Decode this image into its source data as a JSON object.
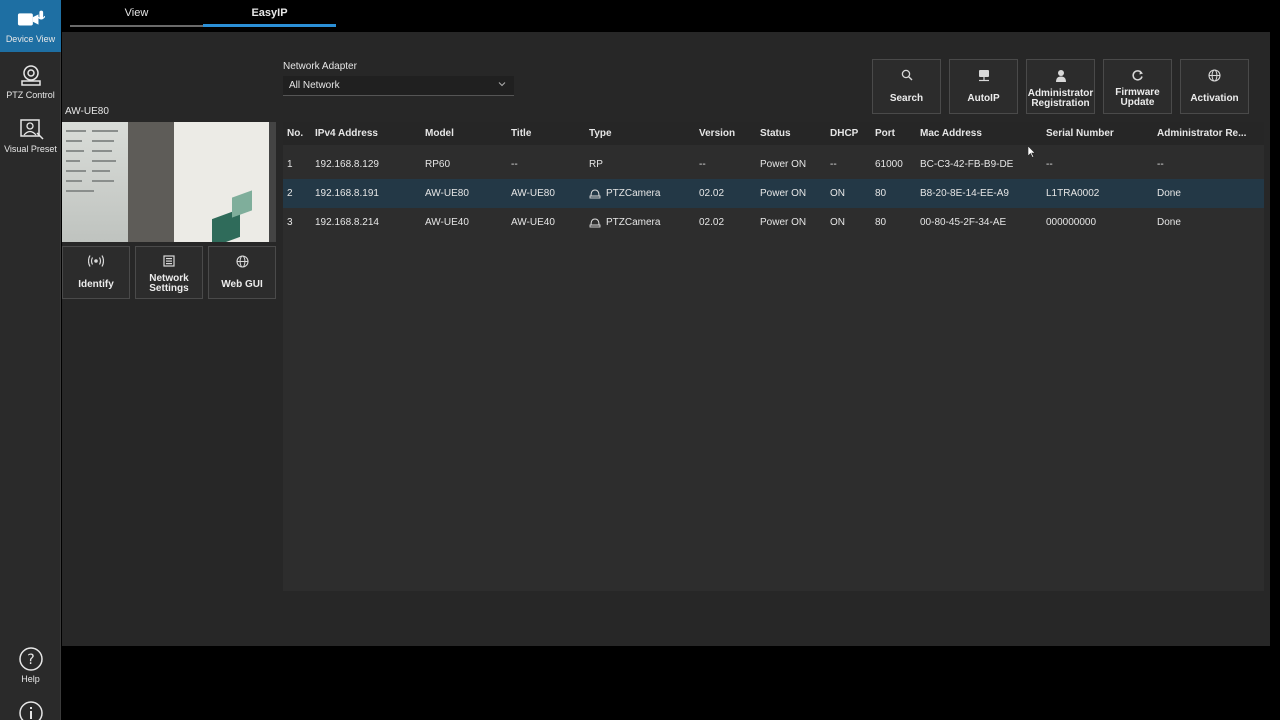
{
  "leftnav": {
    "items": [
      {
        "label": "Device View",
        "icon": "video-camera-mic-icon",
        "active": true
      },
      {
        "label": "PTZ Control",
        "icon": "ptz-camera-icon",
        "active": false
      },
      {
        "label": "Visual Preset",
        "icon": "visual-preset-icon",
        "active": false
      }
    ],
    "help_label": "Help"
  },
  "tabs": [
    {
      "label": "View",
      "active": false
    },
    {
      "label": "EasyIP",
      "active": true
    }
  ],
  "camera": {
    "title": "AW-UE80",
    "actions": [
      {
        "label": "Identify",
        "icon": "broadcast-icon"
      },
      {
        "label": "Network Settings",
        "line1": "Network",
        "line2": "Settings",
        "icon": "network-settings-icon"
      },
      {
        "label": "Web GUI",
        "icon": "globe-icon"
      }
    ]
  },
  "adapter": {
    "label": "Network Adapter",
    "value": "All Network"
  },
  "toolbar": {
    "search": "Search",
    "autoip": "AutoIP",
    "admin_line1": "Administrator",
    "admin_line2": "Registration",
    "firmware_line1": "Firmware",
    "firmware_line2": "Update",
    "activation": "Activation"
  },
  "table": {
    "columns": [
      "No.",
      "IPv4 Address",
      "Model",
      "Title",
      "Type",
      "Version",
      "Status",
      "DHCP",
      "Port",
      "Mac Address",
      "Serial Number",
      "Administrator Re..."
    ],
    "rows": [
      [
        "1",
        "192.168.8.129",
        "RP60",
        "--",
        "RP",
        "--",
        "Power ON",
        "--",
        "61000",
        "BC-C3-42-FB-B9-DE",
        "--",
        "--"
      ],
      [
        "2",
        "192.168.8.191",
        "AW-UE80",
        "AW-UE80",
        "PTZCamera",
        "02.02",
        "Power ON",
        "ON",
        "80",
        "B8-20-8E-14-EE-A9",
        "L1TRA0002",
        "Done"
      ],
      [
        "3",
        "192.168.8.214",
        "AW-UE40",
        "AW-UE40",
        "PTZCamera",
        "02.02",
        "Power ON",
        "ON",
        "80",
        "00-80-45-2F-34-AE",
        "000000000",
        "Done"
      ]
    ],
    "selected_row": 1
  },
  "colors": {
    "accent": "#2b8fd6",
    "nav_active": "#1e6fa3",
    "selected_row": "#233846"
  }
}
